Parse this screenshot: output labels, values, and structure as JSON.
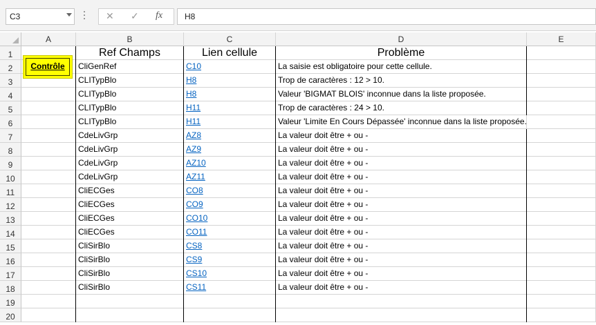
{
  "formula_bar": {
    "name_box": "C3",
    "cancel_icon": "✕",
    "enter_icon": "✓",
    "function_icon": "fx",
    "formula": "H8"
  },
  "columns": [
    "A",
    "B",
    "C",
    "D",
    "E"
  ],
  "rows": [
    "1",
    "2",
    "3",
    "4",
    "5",
    "6",
    "7",
    "8",
    "9",
    "10",
    "11",
    "12",
    "13",
    "14",
    "15",
    "16",
    "17",
    "18",
    "19",
    "20"
  ],
  "header": {
    "ref": "Ref Champs",
    "link": "Lien cellule",
    "problem": "Problème"
  },
  "button": {
    "label": "Contrôle"
  },
  "table": [
    {
      "ref": "CliGenRef",
      "link": "C10",
      "problem": "La saisie est obligatoire pour cette cellule."
    },
    {
      "ref": "CLITypBlo",
      "link": "H8",
      "problem": "Trop de caractères : 12 > 10."
    },
    {
      "ref": "CLITypBlo",
      "link": "H8",
      "problem": "Valeur 'BIGMAT BLOIS' inconnue dans la liste proposée."
    },
    {
      "ref": "CLITypBlo",
      "link": "H11",
      "problem": "Trop de caractères : 24 > 10."
    },
    {
      "ref": "CLITypBlo",
      "link": "H11",
      "problem": "Valeur 'Limite En Cours Dépassée' inconnue dans la liste proposée."
    },
    {
      "ref": "CdeLivGrp",
      "link": "AZ8",
      "problem": "La valeur doit être + ou -"
    },
    {
      "ref": "CdeLivGrp",
      "link": "AZ9",
      "problem": "La valeur doit être + ou -"
    },
    {
      "ref": "CdeLivGrp",
      "link": "AZ10",
      "problem": "La valeur doit être + ou -"
    },
    {
      "ref": "CdeLivGrp",
      "link": "AZ11",
      "problem": "La valeur doit être + ou -"
    },
    {
      "ref": "CliECGes",
      "link": "CO8",
      "problem": "La valeur doit être + ou -"
    },
    {
      "ref": "CliECGes",
      "link": "CO9",
      "problem": "La valeur doit être + ou -"
    },
    {
      "ref": "CliECGes",
      "link": "CO10",
      "problem": "La valeur doit être + ou -"
    },
    {
      "ref": "CliECGes",
      "link": "CO11",
      "problem": "La valeur doit être + ou -"
    },
    {
      "ref": "CliSirBlo",
      "link": "CS8",
      "problem": "La valeur doit être + ou -"
    },
    {
      "ref": "CliSirBlo",
      "link": "CS9",
      "problem": "La valeur doit être + ou -"
    },
    {
      "ref": "CliSirBlo",
      "link": "CS10",
      "problem": "La valeur doit être + ou -"
    },
    {
      "ref": "CliSirBlo",
      "link": "CS11",
      "problem": "La valeur doit être + ou -"
    }
  ]
}
